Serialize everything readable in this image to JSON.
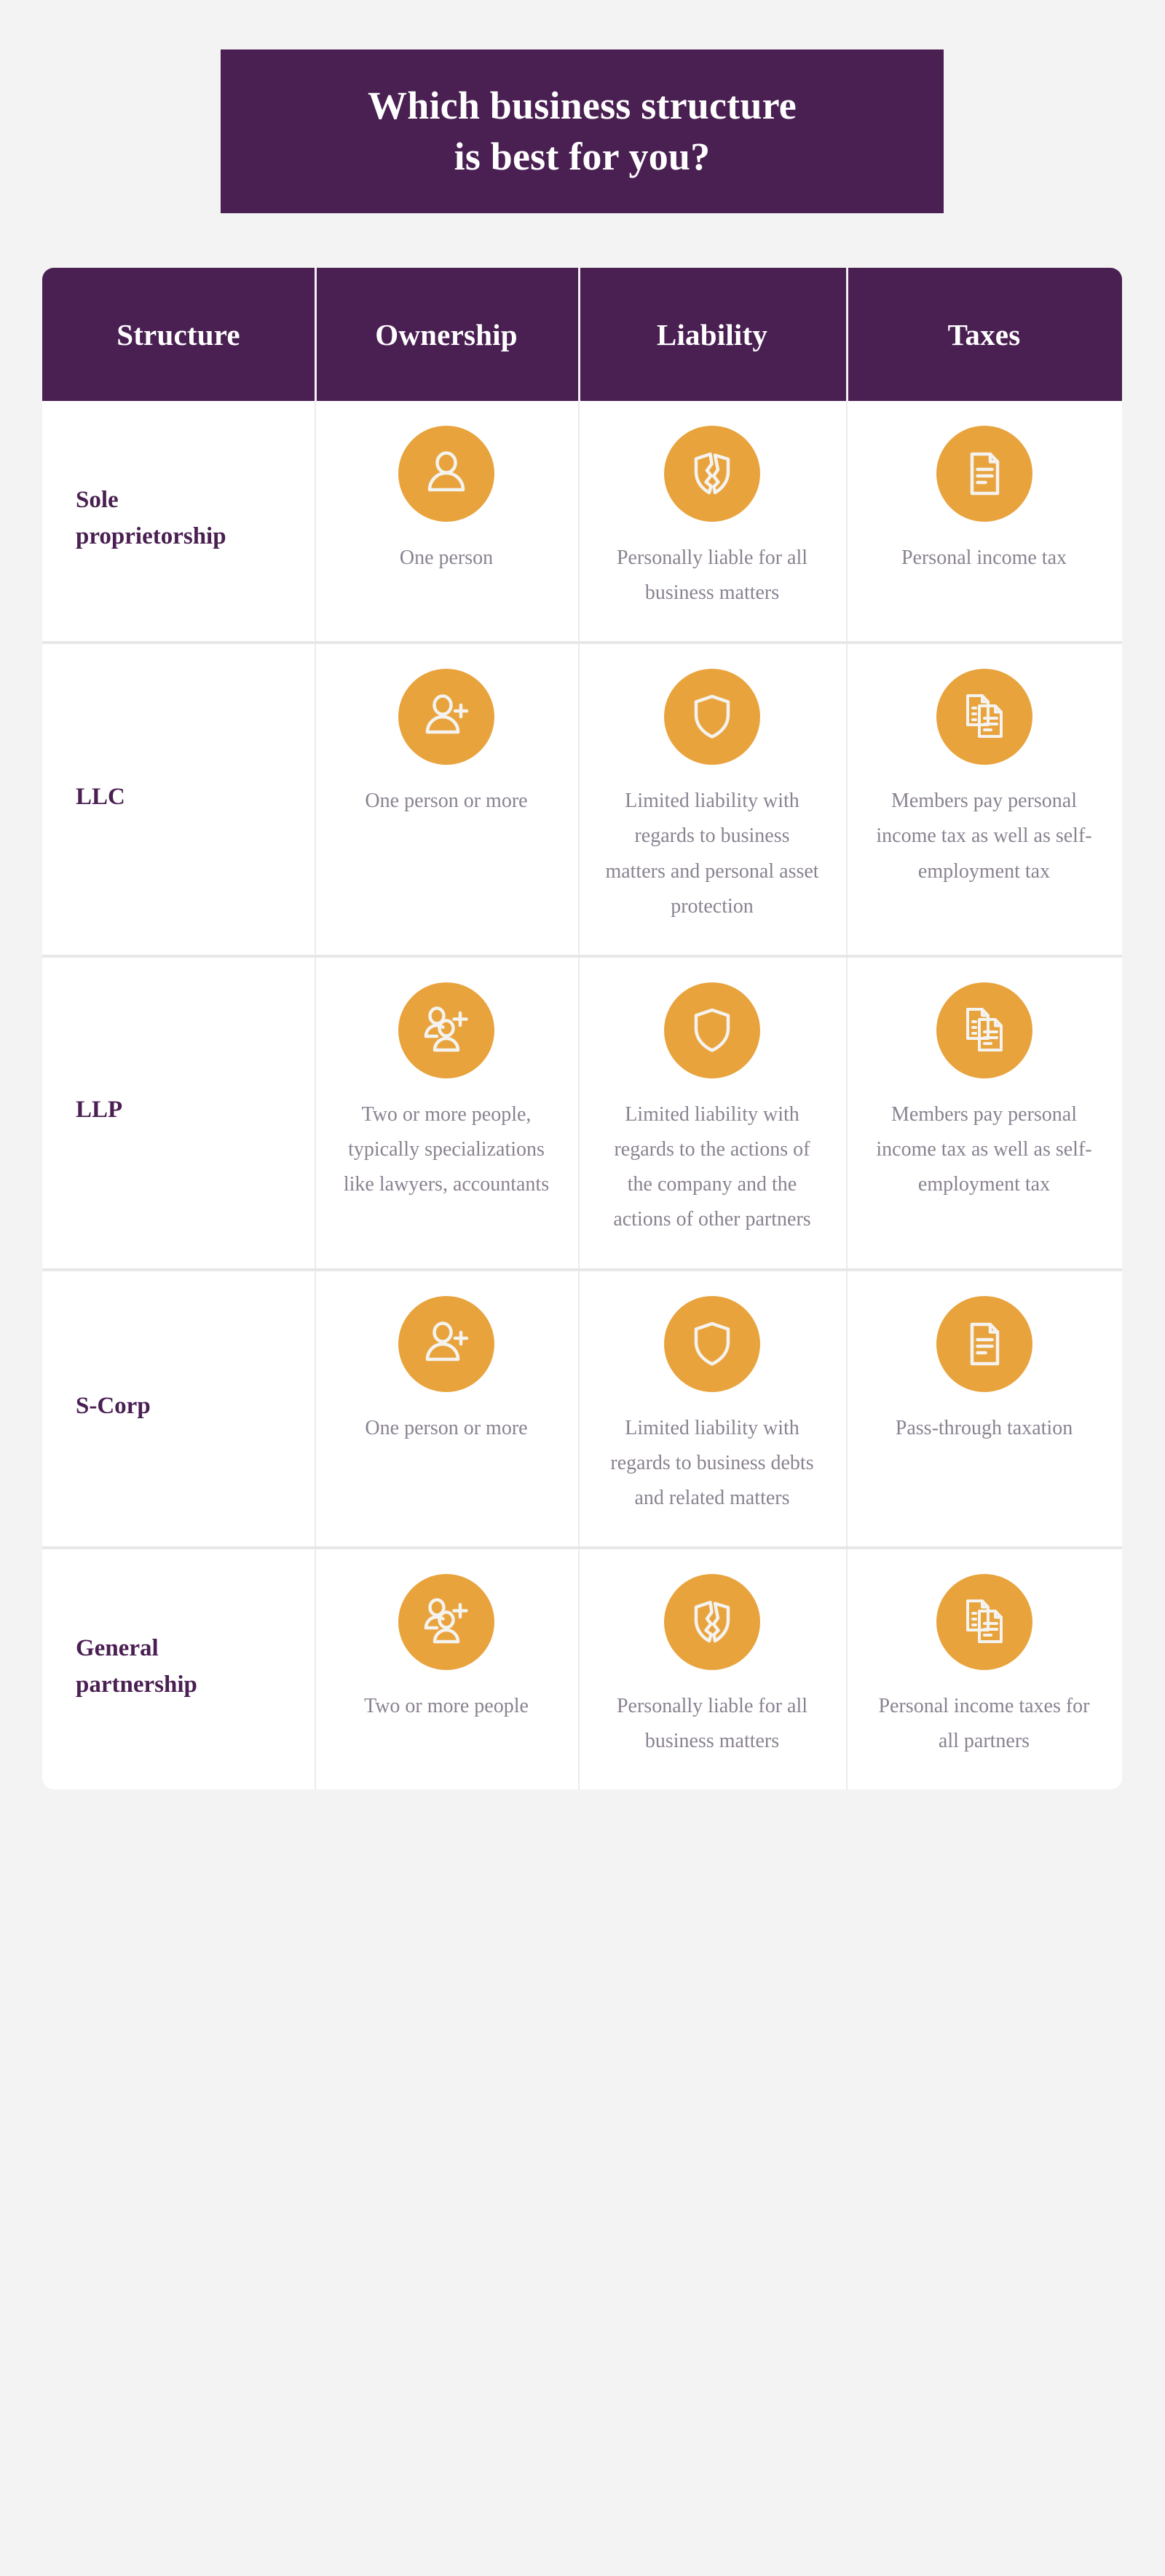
{
  "title": {
    "text": "Which business structure\nis best for you?"
  },
  "colors": {
    "brand_purple": "#4a1f52",
    "accent_orange": "#e8a33d",
    "body_text_gray": "#8a8290",
    "page_background": "#f2f3f2",
    "table_background": "#ffffff",
    "row_divider": "#e7e7e7",
    "column_divider": "#ebebeb"
  },
  "table": {
    "columns": [
      {
        "key": "structure",
        "label": "Structure"
      },
      {
        "key": "ownership",
        "label": "Ownership"
      },
      {
        "key": "liability",
        "label": "Liability"
      },
      {
        "key": "taxes",
        "label": "Taxes"
      }
    ],
    "rows": [
      {
        "structure": "Sole\nproprietorship",
        "ownership": {
          "icon": "person-icon",
          "text": "One person"
        },
        "liability": {
          "icon": "broken-shield-icon",
          "text": "Personally liable for all business matters"
        },
        "taxes": {
          "icon": "document-icon",
          "text": "Personal income tax"
        }
      },
      {
        "structure": "LLC",
        "ownership": {
          "icon": "person-add-icon",
          "text": "One person or more"
        },
        "liability": {
          "icon": "shield-icon",
          "text": "Limited liability with regards to business matters and personal asset protection"
        },
        "taxes": {
          "icon": "documents-icon",
          "text": "Members pay personal income tax as well as self-employment tax"
        }
      },
      {
        "structure": "LLP",
        "ownership": {
          "icon": "people-add-icon",
          "text": "Two or more people, typically specializations like lawyers, accountants"
        },
        "liability": {
          "icon": "shield-icon",
          "text": "Limited liability with regards to the actions of the company and the actions of other partners"
        },
        "taxes": {
          "icon": "documents-icon",
          "text": "Members pay personal income tax as well as self-employment tax"
        }
      },
      {
        "structure": "S-Corp",
        "ownership": {
          "icon": "person-add-icon",
          "text": "One person or more"
        },
        "liability": {
          "icon": "shield-icon",
          "text": "Limited liability with regards to business debts and related matters"
        },
        "taxes": {
          "icon": "document-icon",
          "text": "Pass-through taxation"
        }
      },
      {
        "structure": "General\npartnership",
        "ownership": {
          "icon": "people-add-icon",
          "text": "Two or more people"
        },
        "liability": {
          "icon": "broken-shield-icon",
          "text": "Personally liable for all business matters"
        },
        "taxes": {
          "icon": "documents-icon",
          "text": "Personal income taxes for all partners"
        }
      }
    ]
  }
}
